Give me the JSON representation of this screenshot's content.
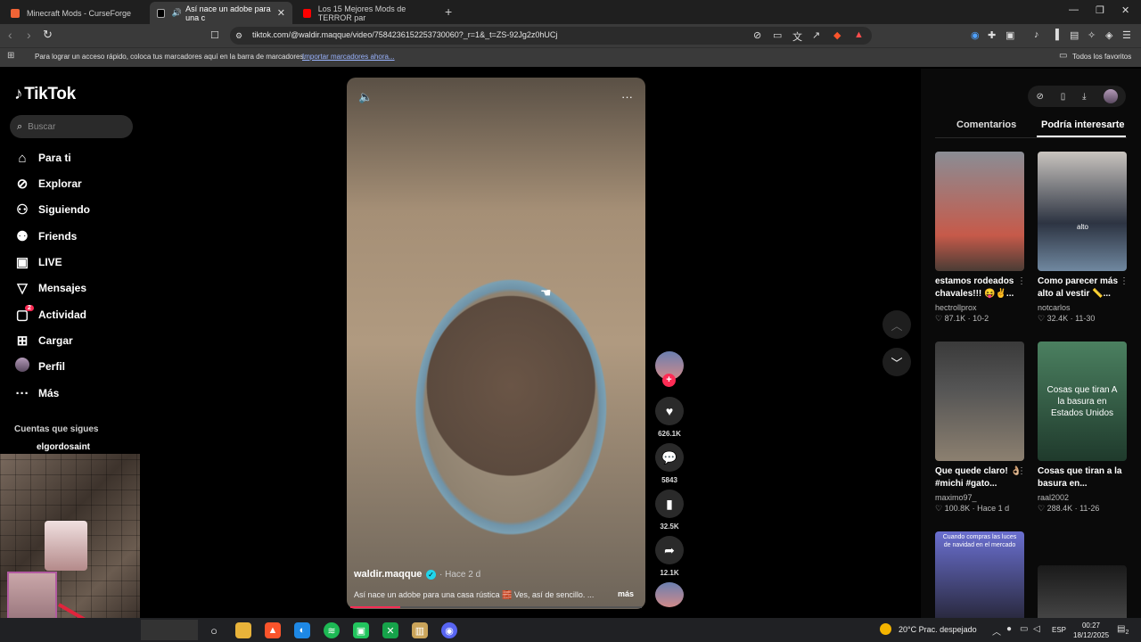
{
  "browser": {
    "tabs": [
      {
        "title": "Minecraft Mods - CurseForge"
      },
      {
        "title": "Así nace un adobe para una c"
      },
      {
        "title": "Los 15 Mejores Mods de TERROR par"
      }
    ],
    "url": "tiktok.com/@waldir.maqque/video/7584236152253730060?_r=1&_t=ZS-92Jg2z0hUCj",
    "bookmarks_text": "Para lograr un acceso rápido, coloca tus marcadores aquí en la barra de marcadores.",
    "bookmarks_link": "Importar marcadores ahora...",
    "favorites": "Todos los favoritos"
  },
  "tiktok": {
    "logo": "TikTok",
    "search_placeholder": "Buscar",
    "menu": [
      {
        "label": "Para ti",
        "icon": "home-icon"
      },
      {
        "label": "Explorar",
        "icon": "compass-icon"
      },
      {
        "label": "Siguiendo",
        "icon": "following-icon"
      },
      {
        "label": "Friends",
        "icon": "friends-icon"
      },
      {
        "label": "LIVE",
        "icon": "live-icon"
      },
      {
        "label": "Mensajes",
        "icon": "messages-icon"
      },
      {
        "label": "Actividad",
        "icon": "activity-icon",
        "badge": "2"
      },
      {
        "label": "Cargar",
        "icon": "upload-icon"
      },
      {
        "label": "Perfil",
        "icon": "profile-avatar"
      },
      {
        "label": "Más",
        "icon": "more-icon"
      }
    ],
    "following_title": "Cuentas que sigues",
    "following_first": "elgordosaint"
  },
  "video": {
    "author": "waldir.maqque",
    "posted": "· Hace 2 d",
    "caption": "Así nace un adobe para una casa rústica 🧱 Ves, así de sencillo. ...",
    "more": "más",
    "progress": 0.17,
    "likes": "626.1K",
    "comments": "5843",
    "saves": "32.5K",
    "shares": "12.1K"
  },
  "panel": {
    "tab_comments": "Comentarios",
    "tab_interest": "Podría interesarte",
    "cards": [
      {
        "title": "estamos rodeados chavales!!! 😝✌️...",
        "user": "hectrollprox",
        "stats": "♡ 87.1K · 10-2",
        "colors": [
          "#8a8d95",
          "#c65a4a"
        ]
      },
      {
        "title": "Como parecer más alto al vestir 📏...",
        "user": "notcarlos",
        "stats": "♡ 32.4K · 11-30",
        "colors": [
          "#c9c4bf",
          "#2d3442"
        ]
      },
      {
        "title": "Que quede claro! 👌🏼 #michi #gato...",
        "user": "maximo97_",
        "stats": "♡ 100.8K · Hace 1 d",
        "colors": [
          "#3a3a3a",
          "#8c8070"
        ]
      },
      {
        "title": "Cosas que tiran a la basura en...",
        "user": "raal2002",
        "stats": "♡ 288.4K · 11-26",
        "colors": [
          "#4b8060",
          "#1f3a2c"
        ],
        "overlay": "Cosas que tiran A la basura en Estados Unidos"
      },
      {
        "title": "",
        "user": "",
        "stats": "",
        "colors": [
          "#6a6fd0",
          "#2a2a40"
        ],
        "overlay": "Cuando compras las luces de navidad en el mercado"
      },
      {
        "title": "",
        "user": "",
        "stats": "",
        "colors": [
          "#1a1a1a",
          "#444"
        ]
      }
    ],
    "thumb2_overlay": "alto"
  },
  "taskbar": {
    "weather": "20°C  Prac. despejado",
    "lang": "ESP",
    "time": "00:27",
    "date": "18/12/2025",
    "notif": "2"
  }
}
